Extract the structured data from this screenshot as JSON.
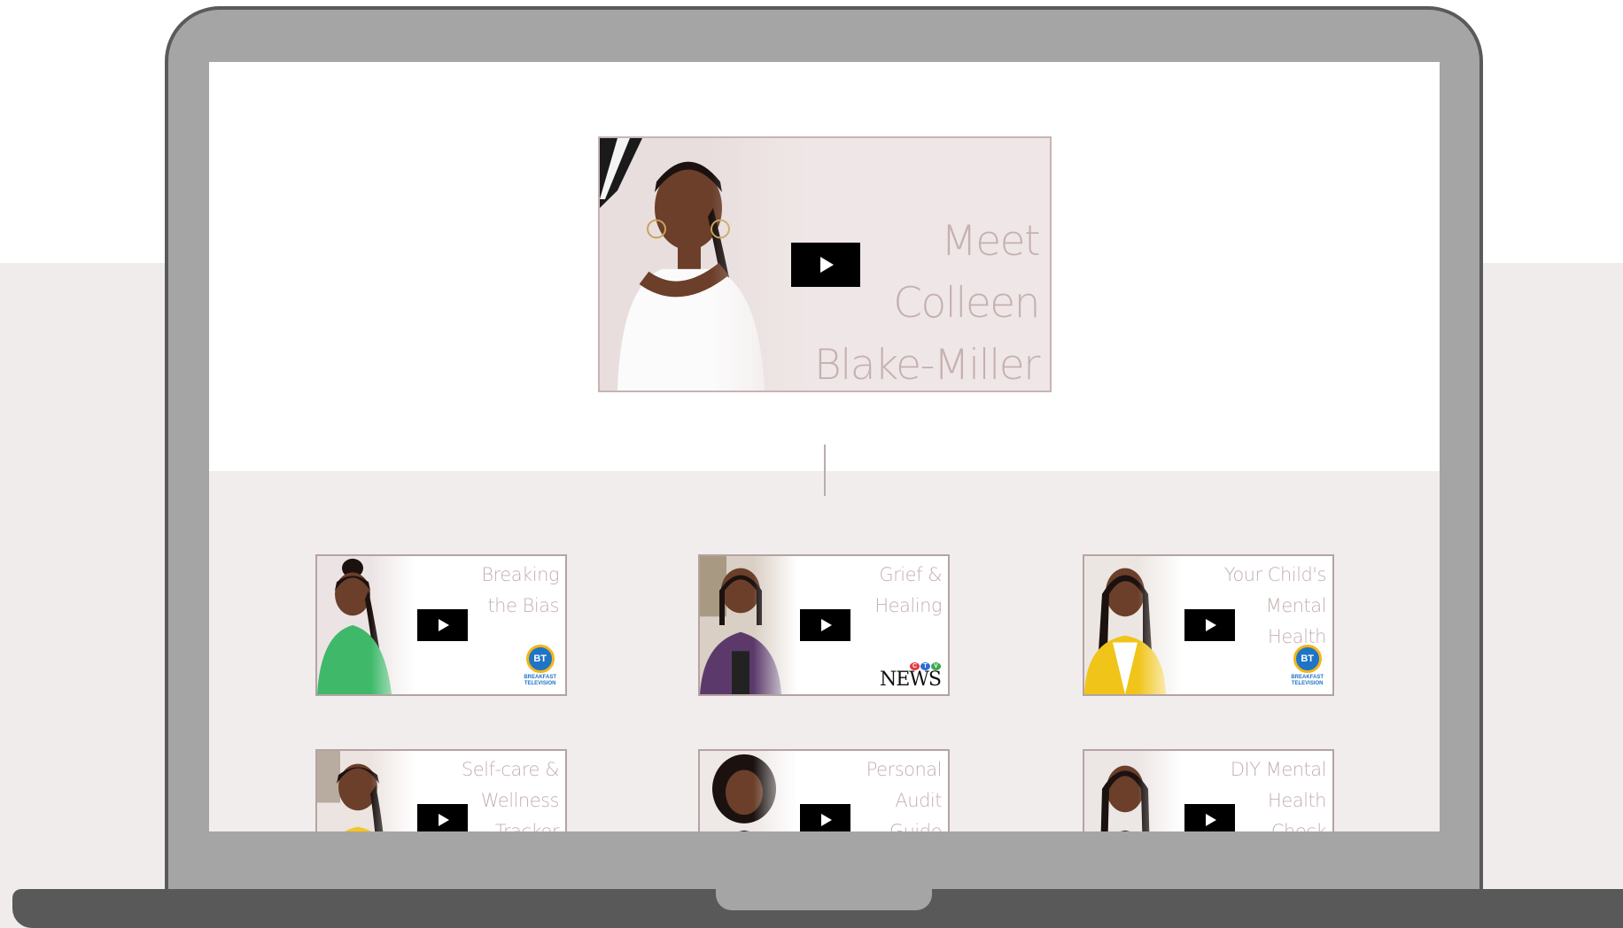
{
  "colors": {
    "accent_text": "#c4afaf",
    "lower_section_bg": "#f2eded",
    "laptop_frame": "#a5a5a5",
    "laptop_base": "#595959",
    "play_button": "#000000"
  },
  "hero_video": {
    "title": "Meet\nColleen\nBlake-Miller",
    "play_icon": "play-icon"
  },
  "videos": [
    {
      "title": "Breaking\nthe Bias",
      "logo": "breakfast-television-logo",
      "logo_text": "BT",
      "logo_caption": "BREAKFAST\nTELEVISION",
      "shirt_color": "#3fb86a"
    },
    {
      "title": "Grief &\nHealing",
      "logo": "ctv-news-logo",
      "logo_text": "NEWS",
      "shirt_color": "#5b3a6b"
    },
    {
      "title": "Your Child's\nMental\nHealth",
      "logo": "breakfast-television-logo",
      "logo_text": "BT",
      "logo_caption": "BREAKFAST\nTELEVISION",
      "shirt_color": "#f0c419"
    },
    {
      "title": "Self-care &\nWellness\nTracker",
      "shirt_color": "#f3c623"
    },
    {
      "title": "Personal\nAudit\nGuide",
      "shirt_color": "#2b2b2b"
    },
    {
      "title": "DIY Mental\nHealth\nCheck",
      "shirt_color": "#3a3a3a"
    }
  ]
}
